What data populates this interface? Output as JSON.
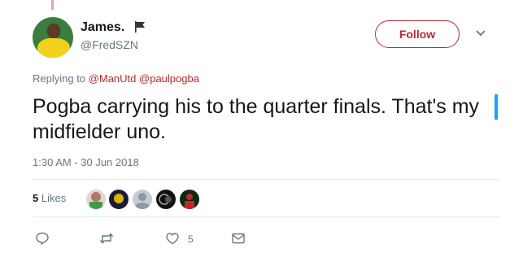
{
  "user": {
    "name": "James.",
    "handle": "@FredSZN"
  },
  "follow_label": "Follow",
  "reply": {
    "prefix": "Replying to",
    "mentions": [
      "@ManUtd",
      "@paulpogba"
    ]
  },
  "tweet_text": "Pogba carrying his to the quarter finals. That's my midfielder uno.",
  "timestamp": "1:30 AM - 30 Jun 2018",
  "likes": {
    "count": "5",
    "label": "Likes"
  },
  "likers": [
    {
      "name": "liker-1",
      "color": "#d9b8b0"
    },
    {
      "name": "liker-2",
      "color": "#1a1a3a"
    },
    {
      "name": "liker-3",
      "color": "#c5cbd1"
    },
    {
      "name": "liker-4",
      "color": "#111111"
    },
    {
      "name": "liker-5",
      "color": "#0b2a12"
    }
  ],
  "actions": {
    "reply_icon": "reply-icon",
    "retweet_icon": "retweet-icon",
    "like_icon": "heart-icon",
    "like_count": "5",
    "dm_icon": "envelope-icon"
  },
  "colors": {
    "accent": "#c0272d",
    "muted": "#657786",
    "blue": "#1da1f2"
  }
}
